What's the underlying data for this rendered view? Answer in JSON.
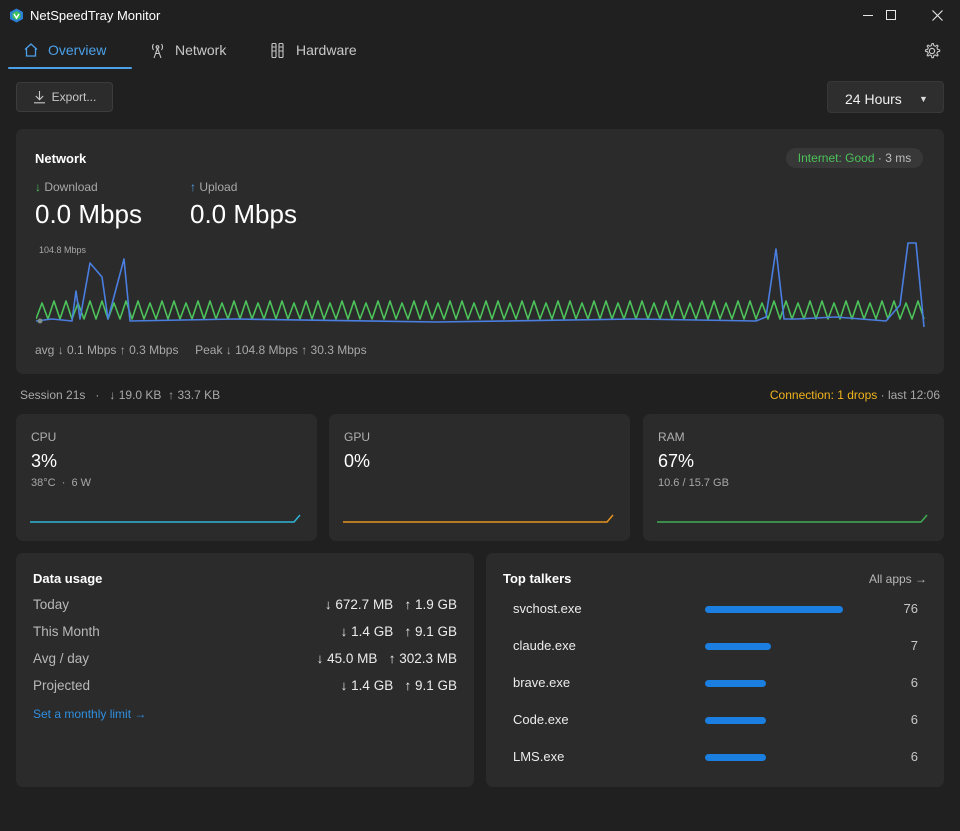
{
  "window": {
    "title": "NetSpeedTray Monitor"
  },
  "tabs": [
    {
      "label": "Overview",
      "icon": "home-icon",
      "active": true
    },
    {
      "label": "Network",
      "icon": "antenna-icon",
      "active": false
    },
    {
      "label": "Hardware",
      "icon": "hardware-icon",
      "active": false
    }
  ],
  "toolbar": {
    "export_label": "Export...",
    "range_value": "24 Hours"
  },
  "network": {
    "title": "Network",
    "internet_status": "Internet: Good",
    "latency": "· 3 ms",
    "download_label": "Download",
    "download_value": "0.0 Mbps",
    "upload_label": "Upload",
    "upload_value": "0.0 Mbps",
    "chart_max_label": "104.8 Mbps",
    "avg_label": "avg",
    "avg_down": "↓ 0.1 Mbps",
    "avg_up": "↑ 0.3 Mbps",
    "peak_label": "Peak",
    "peak_down": "↓ 104.8 Mbps",
    "peak_up": "↑ 30.3 Mbps",
    "colors": {
      "download": "#4cc25a",
      "upload": "#4a7ee0"
    }
  },
  "session": {
    "label": "Session 21s",
    "sep": "·",
    "transfer": "↓ 19.0 KB  ↑ 33.7 KB",
    "connection": "Connection: 1 drops",
    "last": "· last 12:06"
  },
  "hardware": {
    "cpu": {
      "label": "CPU",
      "value": "3%",
      "sub": "38°C  ·  6 W",
      "color": "#2fb5d8"
    },
    "gpu": {
      "label": "GPU",
      "value": "0%",
      "sub": "",
      "color": "#e8941c"
    },
    "ram": {
      "label": "RAM",
      "value": "67%",
      "sub": "10.6 / 15.7 GB",
      "color": "#3fae54"
    }
  },
  "data_usage": {
    "title": "Data usage",
    "rows": [
      {
        "label": "Today",
        "down": "↓ 672.7 MB",
        "up": "↑ 1.9 GB"
      },
      {
        "label": "This Month",
        "down": "↓ 1.4 GB",
        "up": "↑ 9.1 GB"
      },
      {
        "label": "Avg / day",
        "down": "↓ 45.0 MB",
        "up": "↑ 302.3 MB"
      },
      {
        "label": "Projected",
        "down": "↓ 1.4 GB",
        "up": "↑ 9.1 GB"
      }
    ],
    "limit_link": "Set a monthly limit →"
  },
  "top_talkers": {
    "title": "Top talkers",
    "all_apps": "All apps →",
    "accent": "#1a7fe0",
    "items": [
      {
        "name": "svchost.exe",
        "count": 76,
        "fraction": 1.0
      },
      {
        "name": "claude.exe",
        "count": 7,
        "fraction": 0.48
      },
      {
        "name": "brave.exe",
        "count": 6,
        "fraction": 0.44
      },
      {
        "name": "Code.exe",
        "count": 6,
        "fraction": 0.44
      },
      {
        "name": "LMS.exe",
        "count": 6,
        "fraction": 0.44
      }
    ]
  }
}
